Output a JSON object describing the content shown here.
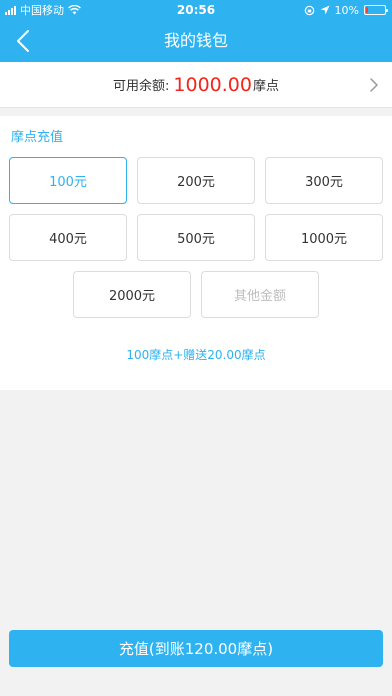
{
  "status_bar": {
    "carrier": "中国移动",
    "time": "20:56",
    "battery_percent": "10%",
    "battery_level": 0.1
  },
  "nav": {
    "title": "我的钱包"
  },
  "balance": {
    "label": "可用余额:",
    "value": "1000.00",
    "unit": "摩点"
  },
  "recharge": {
    "section_title": "摩点充值",
    "amounts": [
      "100元",
      "200元",
      "300元",
      "400元",
      "500元",
      "1000元",
      "2000元"
    ],
    "selected_index": 0,
    "other_label": "其他金额",
    "bonus_text": "100摩点+赠送20.00摩点"
  },
  "submit": {
    "label": "充值(到账120.00摩点)"
  },
  "colors": {
    "accent": "#2eb3f0",
    "balance_red": "#f5251b",
    "battery_red": "#ff3b30"
  }
}
